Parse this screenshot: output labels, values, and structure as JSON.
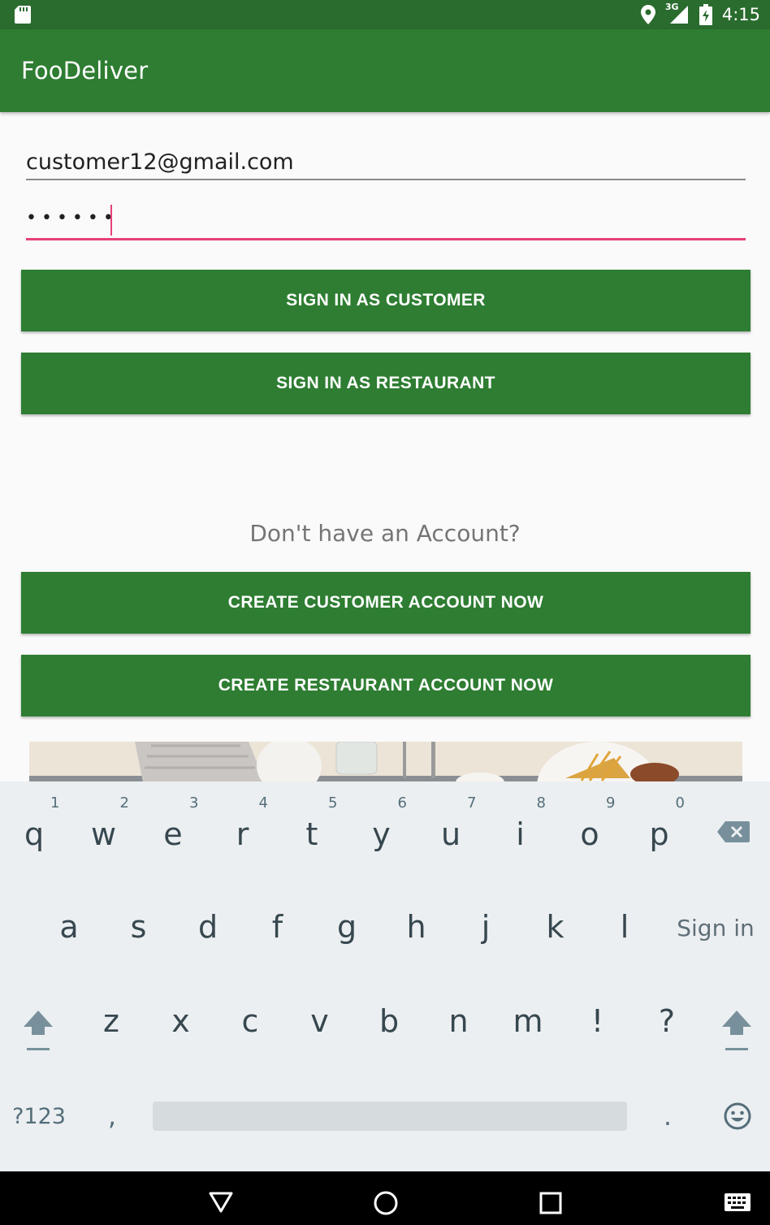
{
  "status_bar": {
    "time": "4:15",
    "network_label": "3G",
    "icons": [
      "sd-card-icon",
      "location-icon",
      "signal-icon",
      "battery-icon"
    ]
  },
  "app_bar": {
    "title": "FooDeliver"
  },
  "form": {
    "email_value": "customer12@gmail.com",
    "password_value": "••••••"
  },
  "buttons": {
    "sign_in_customer": "SIGN IN AS CUSTOMER",
    "sign_in_restaurant": "SIGN IN AS RESTAURANT",
    "create_customer": "CREATE CUSTOMER ACCOUNT NOW",
    "create_restaurant": "CREATE RESTAURANT ACCOUNT NOW"
  },
  "no_account_text": "Don't have an Account?",
  "keyboard": {
    "row1": [
      "q",
      "w",
      "e",
      "r",
      "t",
      "y",
      "u",
      "i",
      "o",
      "p"
    ],
    "row1_hints": [
      "1",
      "2",
      "3",
      "4",
      "5",
      "6",
      "7",
      "8",
      "9",
      "0"
    ],
    "row2": [
      "a",
      "s",
      "d",
      "f",
      "g",
      "h",
      "j",
      "k",
      "l"
    ],
    "action_label": "Sign in",
    "row3": [
      "z",
      "x",
      "c",
      "v",
      "b",
      "n",
      "m",
      "!",
      "?"
    ],
    "symbols_label": "?123",
    "comma": ",",
    "period": "."
  },
  "colors": {
    "primary": "#2e7d32",
    "primary_dark": "#2a6b2e",
    "accent": "#e5407a",
    "keyboard_bg": "#eceff1"
  }
}
